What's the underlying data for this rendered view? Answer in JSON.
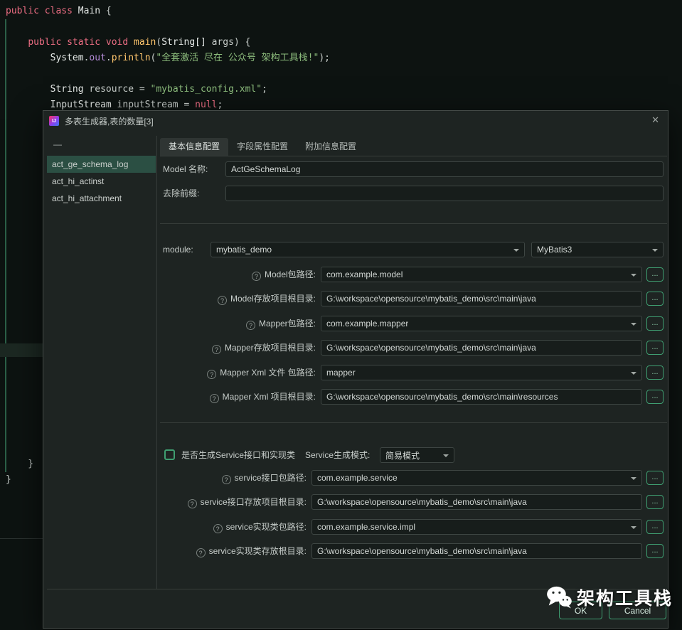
{
  "editor": {
    "l1": [
      "public",
      " ",
      "class",
      " ",
      "Main",
      " {"
    ],
    "l2": [
      "    ",
      "public",
      " ",
      "static",
      " ",
      "void",
      " ",
      "main",
      "(",
      "String[] ",
      "args",
      ") {"
    ],
    "l3": [
      "        ",
      "System",
      ".",
      "out",
      ".",
      "println",
      "(",
      "\"全套激活 尽在 公众号 架构工具栈!\"",
      ");"
    ],
    "l4": [
      "        ",
      "String",
      " resource = ",
      "\"mybatis_config.xml\"",
      ";"
    ],
    "l5": [
      "        ",
      "InputStream",
      " inputStream = ",
      "null",
      ";"
    ],
    "l6": "    }",
    "l7": "}"
  },
  "dialog": {
    "icon_label": "IJ",
    "title": "多表生成器,表的数量[3]",
    "close_label": "✕",
    "list": {
      "collapse_label": "—",
      "items": [
        {
          "label": "act_ge_schema_log"
        },
        {
          "label": "act_hi_actinst"
        },
        {
          "label": "act_hi_attachment"
        }
      ]
    },
    "tabs": [
      {
        "label": "基本信息配置"
      },
      {
        "label": "字段属性配置"
      },
      {
        "label": "附加信息配置"
      }
    ],
    "form": {
      "help_glyph": "?",
      "more_label": "...",
      "model_name_label": "Model 名称:",
      "model_name_value": "ActGeSchemaLog",
      "prefix_label": "去除前缀:",
      "prefix_value": "",
      "module_label": "module:",
      "module_value": "mybatis_demo",
      "generator_value": "MyBatis3",
      "rows": [
        {
          "label": "Model包路径:",
          "value": "com.example.model"
        },
        {
          "label": "Model存放项目根目录:",
          "value": "G:\\workspace\\opensource\\mybatis_demo\\src\\main\\java"
        },
        {
          "label": "Mapper包路径:",
          "value": "com.example.mapper"
        },
        {
          "label": "Mapper存放项目根目录:",
          "value": "G:\\workspace\\opensource\\mybatis_demo\\src\\main\\java"
        },
        {
          "label": "Mapper Xml 文件 包路径:",
          "value": "mapper"
        },
        {
          "label": "Mapper Xml 项目根目录:",
          "value": "G:\\workspace\\opensource\\mybatis_demo\\src\\main\\resources"
        }
      ],
      "service": {
        "checkbox_label": "是否生成Service接口和实现类",
        "mode_label": "Service生成模式:",
        "mode_value": "简易模式",
        "rows": [
          {
            "label": "service接口包路径:",
            "prefix": "com.example.",
            "typo": "service",
            "suffix": ""
          },
          {
            "label": "service接口存放项目根目录:",
            "value": "G:\\workspace\\opensource\\mybatis_demo\\src\\main\\java"
          },
          {
            "label": "service实现类包路径:",
            "prefix": "com.example.",
            "typo": "service",
            "suffix": ".impl"
          },
          {
            "label": "service实现类存放根目录:",
            "value": "G:\\workspace\\opensource\\mybatis_demo\\src\\main\\java"
          }
        ]
      }
    },
    "buttons": {
      "ok": "OK",
      "cancel": "Cancel"
    }
  },
  "watermark": {
    "text": "架构工具栈"
  }
}
